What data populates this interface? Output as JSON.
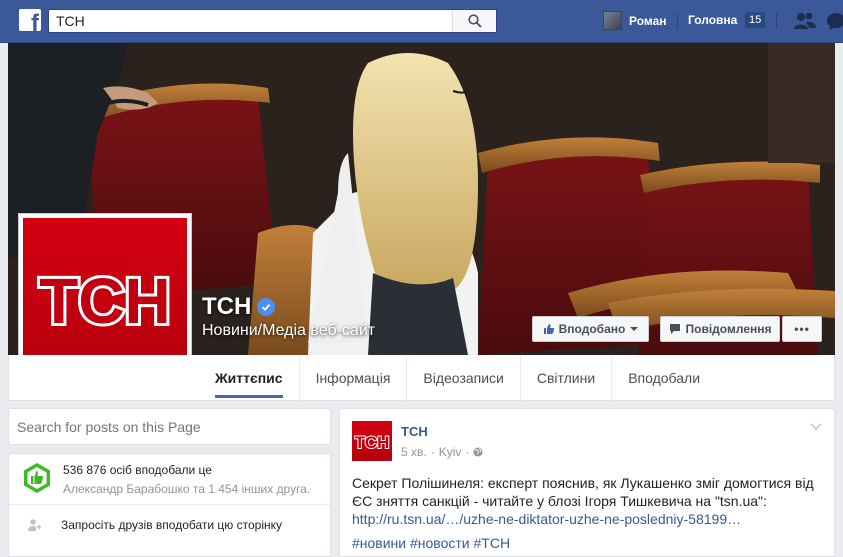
{
  "topbar": {
    "search_value": "ТСН",
    "user_name": "Роман",
    "home_label": "Головна",
    "home_badge": "15"
  },
  "page": {
    "name": "ТСН",
    "category": "Новини/Медіа веб-сайт",
    "logo_text": "ТСН",
    "liked_label": "Вподобано",
    "message_label": "Повідомлення",
    "more_label": "•••"
  },
  "tabs": [
    {
      "label": "Життєпис"
    },
    {
      "label": "Інформація"
    },
    {
      "label": "Відеозаписи"
    },
    {
      "label": "Світлини"
    },
    {
      "label": "Вподобали"
    }
  ],
  "sidebar": {
    "search_placeholder": "Search for posts on this Page",
    "likes_count": "536 876 осіб вподобали це",
    "likes_friends": "Александр Барабошко та 1 454 інших друга.",
    "invite_label": "Запросіть друзів вподобати цю сторінку"
  },
  "post": {
    "author": "ТСН",
    "time": "5 хв.",
    "location": "Kyiv",
    "separator": "·",
    "text": "Секрет Полішинеля: експерт пояснив, як Лукашенко зміг домогтися від ЄС зняття санкцій - читайте у блозі Ігоря Тишкевича на \"tsn.ua\":",
    "link": "http://ru.tsn.ua/…/uzhe-ne-diktator-uzhe-ne-posledniy-58199…",
    "hashtags": "#новини #новости #ТСН"
  },
  "colors": {
    "topbar": "#3b5998",
    "brand_red": "#d40010",
    "link": "#365899",
    "tab_underline": "#4267b2"
  },
  "icons": [
    "facebook-logo-icon",
    "search-icon",
    "friend-requests-icon",
    "verified-icon",
    "like-icon",
    "chevron-down-icon",
    "message-icon",
    "globe-icon",
    "invite-icon",
    "likes-badge-icon"
  ]
}
